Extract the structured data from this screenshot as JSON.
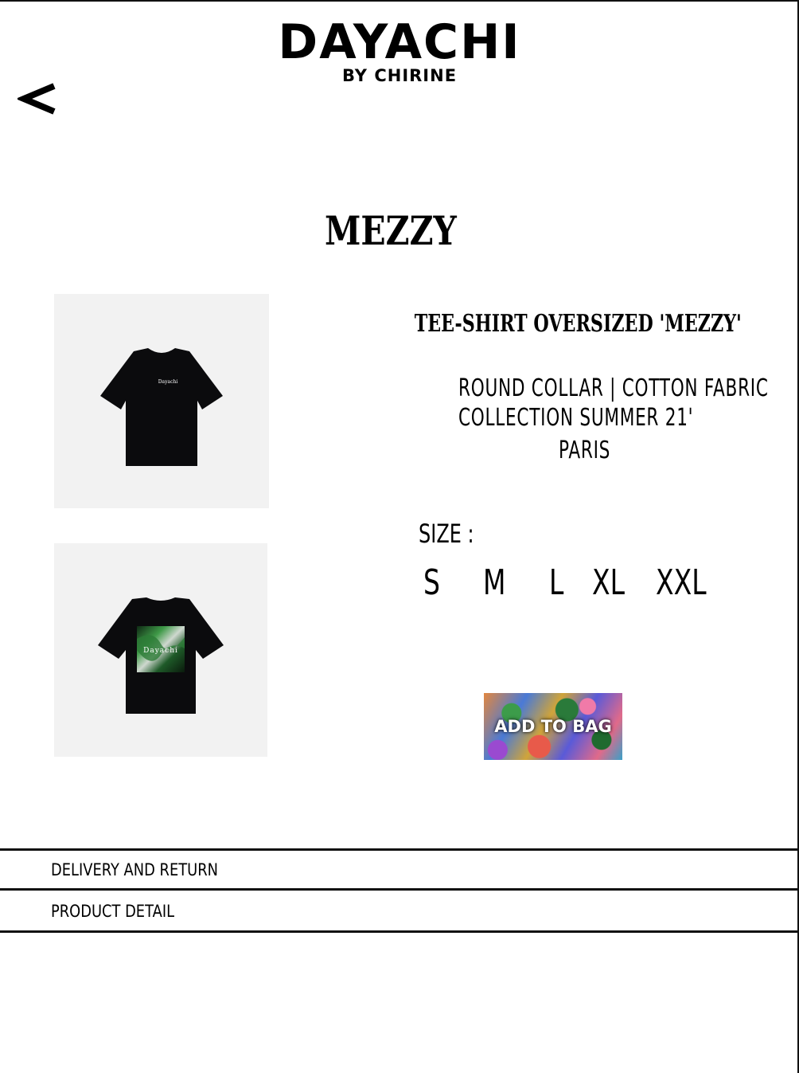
{
  "brand": {
    "name": "DAYACHI",
    "subtitle": "BY CHIRINE"
  },
  "nav": {
    "back_icon": "chevron-left-icon",
    "back_label": "<"
  },
  "collection": {
    "title": "MEZZY"
  },
  "product": {
    "name": "TEE-SHIRT OVERSIZED 'MEZZY'",
    "desc_line1": "ROUND COLLAR | COTTON FABRIC",
    "desc_line2": "COLLECTION SUMMER 21'",
    "desc_line3": "PARIS",
    "front_print": "Dayachi",
    "back_print": "Dayachi"
  },
  "sizes": {
    "label": "SIZE :",
    "options": [
      "S",
      "M",
      "L",
      "XL",
      "XXL"
    ]
  },
  "cart": {
    "add_label": "ADD TO BAG"
  },
  "sections": {
    "delivery": "DELIVERY AND RETURN",
    "detail": "PRODUCT DETAIL"
  }
}
